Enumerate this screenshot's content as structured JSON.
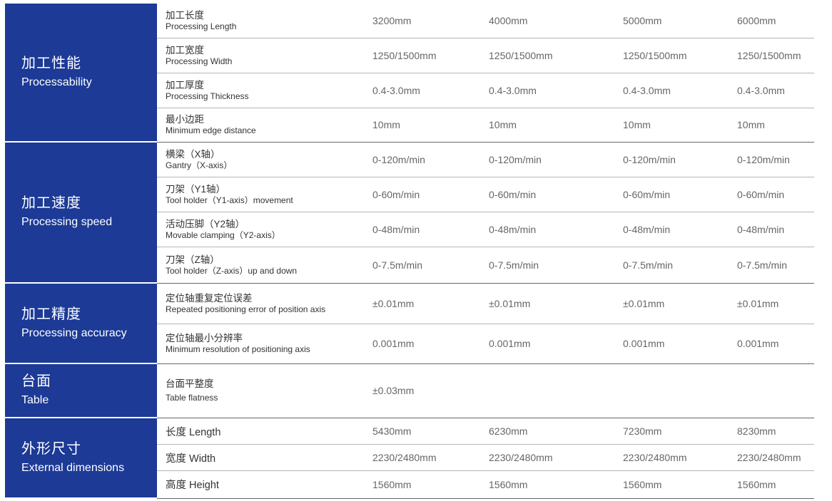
{
  "sections": [
    {
      "zh": "加工性能",
      "en": "Processability",
      "rows": [
        {
          "zh": "加工长度",
          "en": "Processing Length",
          "values": [
            "3200mm",
            "4000mm",
            "5000mm",
            "6000mm"
          ]
        },
        {
          "zh": "加工宽度",
          "en": "Processing Width",
          "values": [
            "1250/1500mm",
            "1250/1500mm",
            "1250/1500mm",
            "1250/1500mm"
          ]
        },
        {
          "zh": "加工厚度",
          "en": "Processing Thickness",
          "values": [
            "0.4-3.0mm",
            "0.4-3.0mm",
            "0.4-3.0mm",
            "0.4-3.0mm"
          ]
        },
        {
          "zh": "最小边距",
          "en": "Minimum edge distance",
          "values": [
            "10mm",
            "10mm",
            "10mm",
            "10mm"
          ]
        }
      ]
    },
    {
      "zh": "加工速度",
      "en": "Processing speed",
      "rows": [
        {
          "zh": "横梁（X轴）",
          "en": "Gantry（X-axis）",
          "values": [
            "0-120m/min",
            "0-120m/min",
            "0-120m/min",
            "0-120m/min"
          ]
        },
        {
          "zh": "刀架（Y1轴）",
          "en": "Tool holder（Y1-axis）movement",
          "values": [
            "0-60m/min",
            "0-60m/min",
            "0-60m/min",
            "0-60m/min"
          ]
        },
        {
          "zh": "活动压脚（Y2轴）",
          "en": "Movable clamping（Y2-axis）",
          "values": [
            "0-48m/min",
            "0-48m/min",
            "0-48m/min",
            "0-48m/min"
          ]
        },
        {
          "zh": "刀架（Z轴）",
          "en": "Tool holder（Z-axis）up and down",
          "values": [
            "0-7.5m/min",
            "0-7.5m/min",
            "0-7.5m/min",
            "0-7.5m/min"
          ]
        }
      ]
    },
    {
      "zh": "加工精度",
      "en": "Processing accuracy",
      "rows": [
        {
          "zh": "定位轴重复定位误差",
          "en": "Repeated positioning error of position axis",
          "values": [
            "±0.01mm",
            "±0.01mm",
            "±0.01mm",
            "±0.01mm"
          ]
        },
        {
          "zh": "定位轴最小分辨率",
          "en": "Minimum resolution of positioning axis",
          "values": [
            "0.001mm",
            "0.001mm",
            "0.001mm",
            "0.001mm"
          ]
        }
      ]
    },
    {
      "zh": "台面",
      "en": "Table",
      "rows": [
        {
          "zh": "台面平整度",
          "en": "Table flatness",
          "values": [
            "±0.03mm"
          ]
        }
      ]
    },
    {
      "zh": "外形尺寸",
      "en": "External dimensions",
      "rows": [
        {
          "label": "长度 Length",
          "values": [
            "5430mm",
            "6230mm",
            "7230mm",
            "8230mm"
          ]
        },
        {
          "label": "宽度 Width",
          "values": [
            "2230/2480mm",
            "2230/2480mm",
            "2230/2480mm",
            "2230/2480mm"
          ]
        },
        {
          "label": "高度 Height",
          "values": [
            "1560mm",
            "1560mm",
            "1560mm",
            "1560mm"
          ]
        }
      ]
    }
  ]
}
